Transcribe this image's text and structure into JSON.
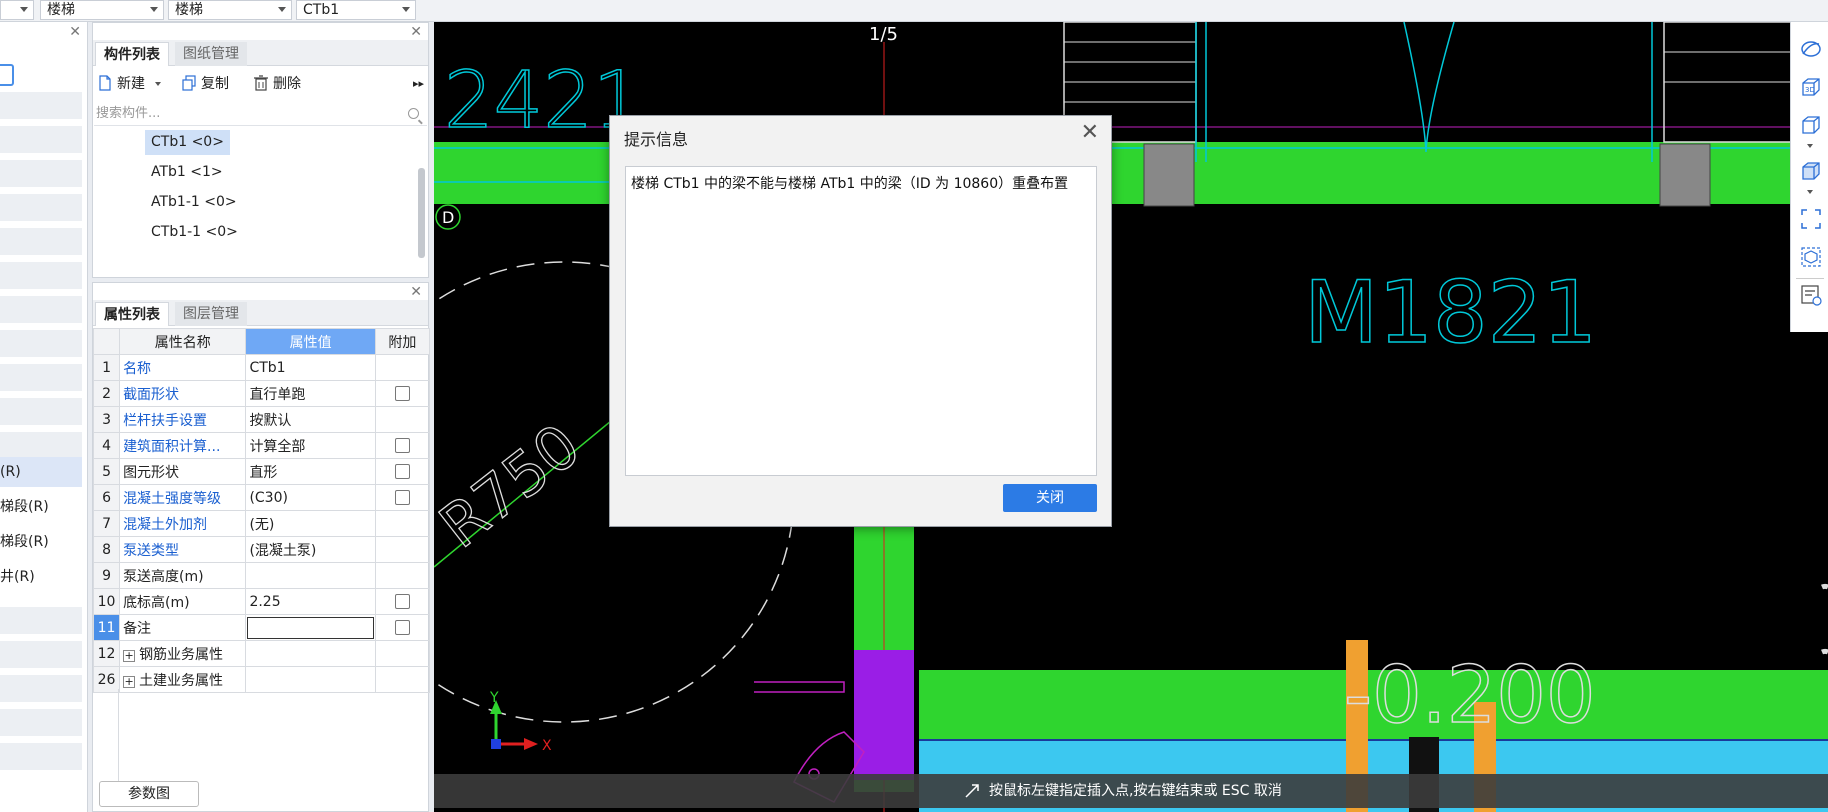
{
  "toolbar": {
    "combo1": "",
    "combo2": "楼梯",
    "combo3": "楼梯",
    "combo4": "CTb1"
  },
  "tree": {
    "items": [
      "(R)",
      "梯段(R)",
      "梯段(R)",
      "井(R)"
    ]
  },
  "component_list": {
    "tabs": [
      "构件列表",
      "图纸管理"
    ],
    "new_label": "新建",
    "copy_label": "复制",
    "delete_label": "删除",
    "search_placeholder": "搜索构件...",
    "items": [
      "CTb1 <0>",
      "ATb1 <1>",
      "ATb1-1 <0>",
      "CTb1-1 <0>"
    ]
  },
  "properties": {
    "tabs": [
      "属性列表",
      "图层管理"
    ],
    "headers": [
      "属性名称",
      "属性值",
      "附加"
    ],
    "rows": [
      {
        "num": "1",
        "name": "名称",
        "value": "CTb1"
      },
      {
        "num": "2",
        "name": "截面形状",
        "value": "直行单跑"
      },
      {
        "num": "3",
        "name": "栏杆扶手设置",
        "value": "按默认"
      },
      {
        "num": "4",
        "name": "建筑面积计算...",
        "value": "计算全部"
      },
      {
        "num": "5",
        "name": "图元形状",
        "value": "直形"
      },
      {
        "num": "6",
        "name": "混凝土强度等级",
        "value": "(C30)"
      },
      {
        "num": "7",
        "name": "混凝土外加剂",
        "value": "(无)"
      },
      {
        "num": "8",
        "name": "泵送类型",
        "value": "(混凝土泵)"
      },
      {
        "num": "9",
        "name": "泵送高度(m)",
        "value": ""
      },
      {
        "num": "10",
        "name": "底标高(m)",
        "value": "2.25"
      },
      {
        "num": "11",
        "name": "备注",
        "value": ""
      },
      {
        "num": "12",
        "name": "钢筋业务属性",
        "value": ""
      },
      {
        "num": "26",
        "name": "土建业务属性",
        "value": ""
      }
    ],
    "param_button": "参数图"
  },
  "canvas": {
    "texts": [
      "1/5",
      "2421",
      "D",
      "M1821",
      "R750",
      "-0.200",
      "Y",
      "X"
    ]
  },
  "dialog": {
    "title": "提示信息",
    "message": "楼梯 CTb1 中的梁不能与楼梯 ATb1 中的梁（ID 为 10860）重叠布置",
    "close_button": "关闭"
  },
  "status": {
    "hint": "按鼠标左键指定插入点,按右键结束或 ESC 取消"
  },
  "colors": {
    "accent": "#2c7be5",
    "canvas_bg": "#000000",
    "beam_green": "#2fd52f",
    "cyan_line": "#00c8d8",
    "magenta": "#c020c0",
    "orange": "#f0a030",
    "light_blue": "#3cc8f0"
  }
}
